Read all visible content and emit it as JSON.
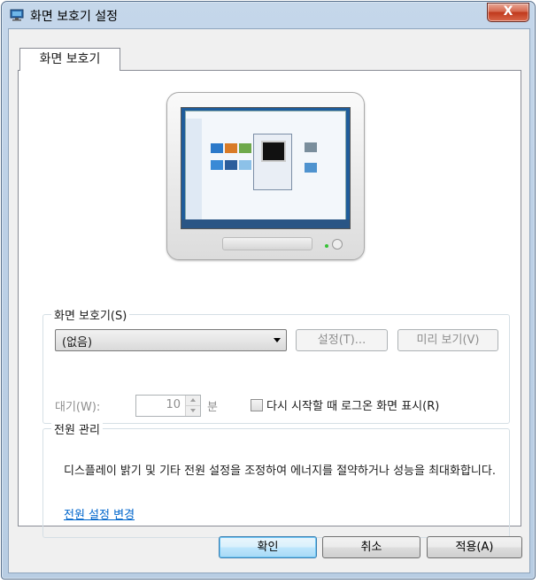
{
  "window": {
    "title": "화면 보호기 설정",
    "close_label": "X"
  },
  "tabs": [
    {
      "label": "화면 보호기"
    }
  ],
  "screensaver_group": {
    "legend": "화면 보호기(S)",
    "selected": "(없음)",
    "settings_label": "설정(T)...",
    "preview_label": "미리 보기(V)",
    "wait_label": "대기(W):",
    "wait_value": "10",
    "wait_unit": "분",
    "resume_checkbox_label": "다시 시작할 때 로그온 화면 표시(R)",
    "resume_checked": false
  },
  "power_group": {
    "legend": "전원 관리",
    "description": "디스플레이 밝기 및 기타 전원 설정을 조정하여 에너지를 절약하거나 성능을 최대화합니다.",
    "link_label": "전원 설정 변경"
  },
  "footer": {
    "ok_label": "확인",
    "cancel_label": "취소",
    "apply_label": "적용(A)"
  },
  "colors": {
    "link": "#0066cc",
    "title_bar": "#bcd0e6",
    "close_button": "#c0391c",
    "default_button": "#bee6fd"
  }
}
